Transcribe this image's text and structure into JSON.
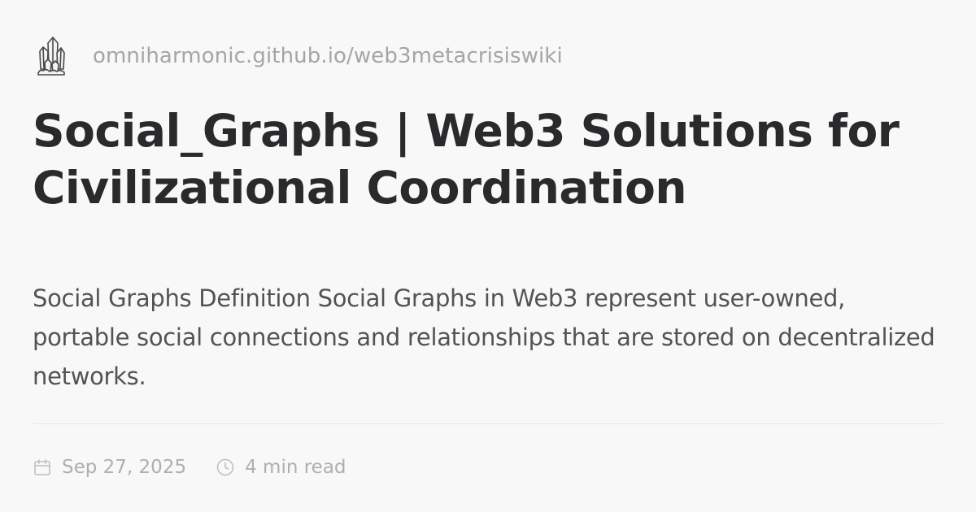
{
  "site": {
    "logo_icon": "crystal-cluster-icon",
    "url": "omniharmonic.github.io/web3metacrisiswiki"
  },
  "article": {
    "title": "Social_Graphs | Web3 Solutions for Civilizational Coordination",
    "description": "Social Graphs Definition Social Graphs in Web3 represent user-owned, portable social connections and relationships that are stored on decentralized networks."
  },
  "meta": {
    "date_icon": "calendar-icon",
    "date": "Sep 27, 2025",
    "read_time_icon": "clock-icon",
    "read_time": "4 min read"
  },
  "colors": {
    "background": "#f9f8f9",
    "title": "#2a292b",
    "description": "#545255",
    "muted": "#a6a4a6",
    "divider": "#e7e5e7"
  }
}
